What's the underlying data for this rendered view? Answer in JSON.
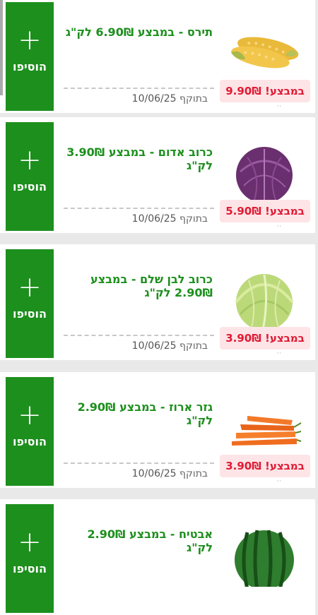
{
  "products": [
    {
      "title": "תירס - במבצע 6.90₪ לק\"ג",
      "price": "במבצע! 9.90₪",
      "valid_label": "בתוקף",
      "valid_date": "10/06/25",
      "add_label": "הוסיפו",
      "icon": "corn-image"
    },
    {
      "title": "כרוב אדום - במבצע 3.90₪ לק\"ג",
      "price": "במבצע! 5.90₪",
      "valid_label": "בתוקף",
      "valid_date": "10/06/25",
      "add_label": "הוסיפו",
      "icon": "red-cabbage-image"
    },
    {
      "title": "כרוב לבן שלם - במבצע 2.90₪ לק\"ג",
      "price": "במבצע! 3.90₪",
      "valid_label": "בתוקף",
      "valid_date": "10/06/25",
      "add_label": "הוסיפו",
      "icon": "white-cabbage-image"
    },
    {
      "title": "גזר ארוז - במבצע 2.90₪ לק\"ג",
      "price": "במבצע! 3.90₪",
      "valid_label": "בתוקף",
      "valid_date": "10/06/25",
      "add_label": "הוסיפו",
      "icon": "carrots-image"
    },
    {
      "title": "אבטיח - במבצע 2.90₪ לק\"ג",
      "add_label": "הוסיפו",
      "icon": "watermelon-image"
    }
  ],
  "colors": {
    "brand_green": "#1d8f1d",
    "sale_red": "#e01b33",
    "badge_bg": "#fde4e7"
  }
}
